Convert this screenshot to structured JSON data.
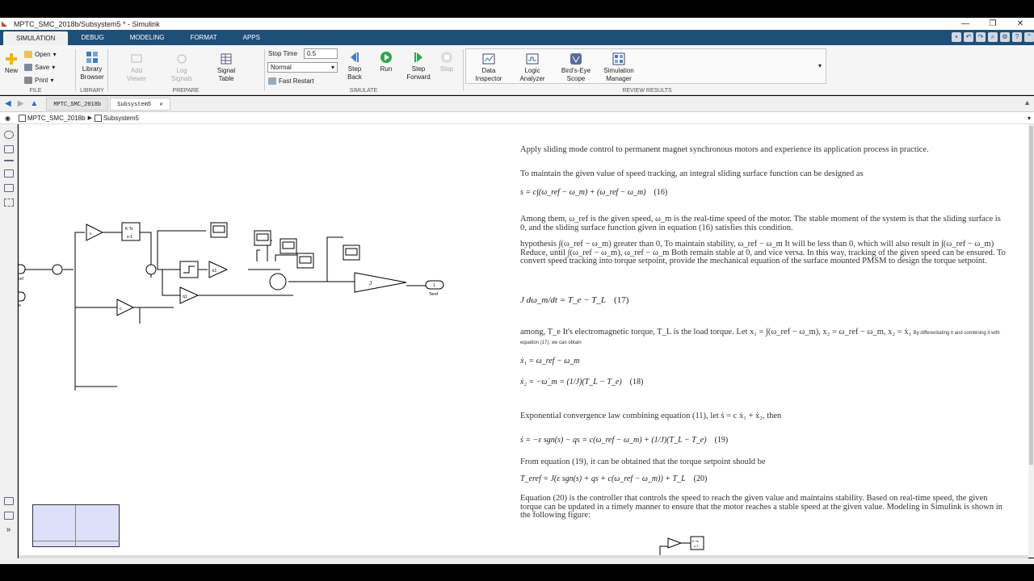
{
  "window": {
    "title": "MPTC_SMC_2018b/Subsystem5 * - Simulink"
  },
  "tabs": [
    "SIMULATION",
    "DEBUG",
    "MODELING",
    "FORMAT",
    "APPS"
  ],
  "ribbon": {
    "file": {
      "new": "New",
      "open": "Open",
      "save": "Save",
      "print": "Print",
      "label": "FILE"
    },
    "library": {
      "browser": "Library Browser",
      "label": "LIBRARY"
    },
    "prepare": {
      "add_viewer": "Add Viewer",
      "log_signals": "Log Signals",
      "signal_table": "Signal Table",
      "label": "PREPARE"
    },
    "simulate": {
      "stop_time_label": "Stop Time",
      "stop_time_value": "0.5",
      "mode": "Normal",
      "fast_restart": "Fast Restart",
      "step_back": "Step Back",
      "run": "Run",
      "step_forward": "Step Forward",
      "stop": "Stop",
      "label": "SIMULATE"
    },
    "review": {
      "data_inspector": "Data Inspector",
      "logic_analyzer": "Logic Analyzer",
      "birds_eye": "Bird's-Eye Scope",
      "sim_manager": "Simulation Manager",
      "label": "REVIEW RESULTS"
    }
  },
  "file_tabs": [
    "MPTC_SMC_2018b",
    "Subsystem5"
  ],
  "breadcrumb": [
    "MPTC_SMC_2018b",
    "Subsystem5"
  ],
  "blocks": {
    "kts_num": "K Ts",
    "kts_den": "z-1",
    "gain_j": "J",
    "out_label": "Teref",
    "out_num": "1",
    "in_label1": "ref",
    "in_label2": "e",
    "k1": "k1",
    "q1": "q1",
    "c": "c"
  },
  "paper": {
    "p1": "Apply sliding mode control to permanent magnet synchronous motors and experience its application process in practice.",
    "p2": "To maintain the given value of speed tracking, an integral sliding surface function can be designed as",
    "eq16": "s = c∫(ω_ref − ω_m) + (ω_ref − ω_m)",
    "eq16_num": "(16)",
    "p3a": "Among them, ω_ref is the given speed, ω_m is the real-time speed of the motor. The stable moment of the system is that the sliding surface is 0, and the sliding surface function given in equation (16) satisfies this condition.",
    "p3b": "hypothesis ∫(ω_ref − ω_m) greater than 0, To maintain stability, ω_ref − ω_m It will be less than 0, which will also result in ∫(ω_ref − ω_m) Reduce, until ∫(ω_ref − ω_m), ω_ref − ω_m Both remain stable at 0, and vice versa. In this way, tracking of the given speed can be ensured. To convert speed tracking into torque setpoint, provide the mechanical equation of the surface mounted PMSM to design the torque setpoint.",
    "eq17": "J dω_m/dt = T_e − T_L",
    "eq17_num": "(17)",
    "p4": "among, T_e It's electromagnetic torque, T_L is the load torque. Let x₁ = ∫(ω_ref − ω_m), x₂ = ω_ref − ω_m, x₂ = ẋ₁",
    "p4_small": "By differentiating it and combining it with equation (17), we can obtain",
    "eq18a": "ẋ₁ = ω_ref − ω_m",
    "eq18b": "ẋ₂ = −ω̇_m = (1/J)(T_L − T_e)",
    "eq18_num": "(18)",
    "p5": "Exponential convergence law combining equation (11), let ṡ = c ẋ₁ + ẋ₂, then",
    "eq19": "ṡ = −ε sgn(s) − qs = c(ω_ref − ω_m) + (1/J)(T_L − T_e)",
    "eq19_num": "(19)",
    "p6": "From equation (19), it can be obtained that the torque setpoint should be",
    "eq20": "T_eref = J(ε sgn(s) + qs + c(ω_ref − ω_m)) + T_L",
    "eq20_num": "(20)",
    "p7": "Equation (20) is the controller that controls the speed to reach the given value and maintains stability. Based on real-time speed, the given torque can be updated in a timely manner to ensure that the motor reaches a stable speed at the given value. Modeling in Simulink is shown in the following figure:"
  }
}
